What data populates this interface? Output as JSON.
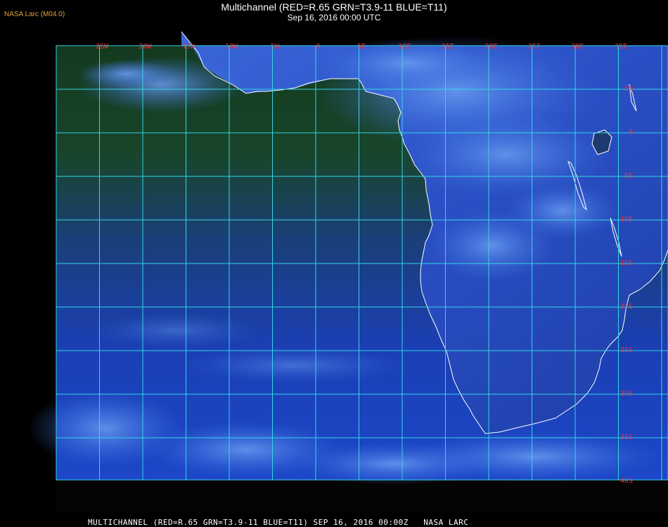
{
  "header": {
    "provider": "NASA Larc (M04.0)",
    "title": "Multichannel (RED=R.65 GRN=T3.9-11 BLUE=T11)",
    "subtitle": "Sep 16, 2016 00:00 UTC"
  },
  "footer": {
    "caption": "MULTICHANNEL (RED=R.65 GRN=T3.9-11 BLUE=T11) SEP 16, 2016 00:00Z   NASA LARC"
  },
  "map": {
    "longitude_labels": [
      "25W",
      "20W",
      "15W",
      "10W",
      "5W",
      "0",
      "5E",
      "10E",
      "15E",
      "20E",
      "25E",
      "30E",
      "35E"
    ],
    "latitude_labels": [
      "5N",
      "0",
      "5S",
      "10S",
      "15S",
      "20S",
      "25S",
      "30S",
      "35S",
      "40S"
    ],
    "colors": {
      "grid": "#33d6e6",
      "coastline": "#ffffff",
      "label": "#ff2a2a",
      "ocean_north": "#163a20",
      "ocean_south": "#1a3ab8",
      "cloud": "#4a7ce8"
    }
  }
}
